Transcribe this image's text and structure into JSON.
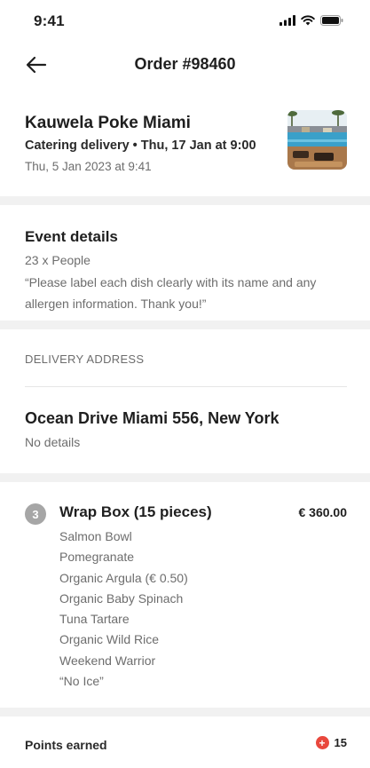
{
  "status_bar": {
    "time": "9:41"
  },
  "header": {
    "title": "Order #98460"
  },
  "restaurant": {
    "name": "Kauwela Poke Miami",
    "delivery": "Catering delivery • Thu, 17 Jan at 9:00",
    "ordered_at": "Thu, 5 Jan 2023 at 9:41"
  },
  "event": {
    "title": "Event details",
    "people": "23 x People",
    "note": "“Please label each dish clearly with its name and any allergen information. Thank you!”"
  },
  "delivery_address": {
    "header": "DELIVERY ADDRESS",
    "address": "Ocean Drive Miami 556, New York",
    "details": "No details"
  },
  "order_item": {
    "quantity": "3",
    "name": "Wrap Box (15 pieces)",
    "price": "€ 360.00",
    "options": [
      "Salmon Bowl",
      "Pomegranate",
      "Organic Argula  (€ 0.50)",
      "Organic Baby Spinach",
      "Tuna Tartare",
      "Organic Wild Rice",
      "Weekend Warrior",
      "“No Ice”"
    ]
  },
  "points": {
    "label": "Points earned",
    "value": "15"
  },
  "colors": {
    "accent": "#e9483d",
    "badge": "#a6a6a6",
    "band": "#f1f1f1"
  },
  "icons": {
    "back": "arrow-left-icon",
    "signal": "cellular-signal-icon",
    "wifi": "wifi-icon",
    "battery": "battery-icon",
    "points": "points-plus-icon"
  }
}
